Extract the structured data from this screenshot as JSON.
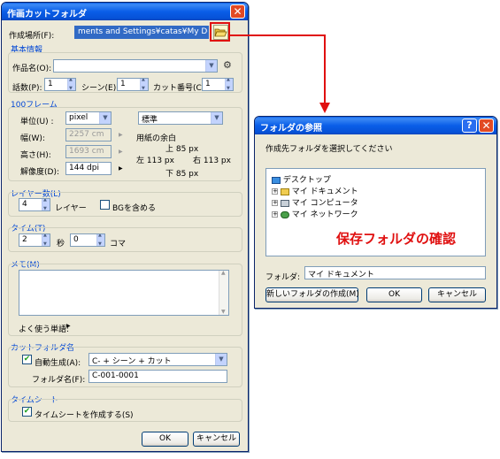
{
  "main_dialog": {
    "title": "作画カットフォルダ",
    "create_location_label": "作成場所(F):",
    "create_location_value": "ments and Settings¥catas¥My Documents",
    "basic_info_header": "基本情報",
    "work_name_label": "作品名(O):",
    "work_name_value": "",
    "episode_label": "話数(P):",
    "episode_value": "1",
    "scene_label": "シーン(E):",
    "scene_value": "1",
    "cut_label": "カット番号(C):",
    "cut_value": "1",
    "frame_header": "100フレーム",
    "unit_label": "単位(U) :",
    "unit_value": "pixel",
    "preset_value": "標準",
    "width_label": "幅(W):",
    "width_value": "2257 cm",
    "height_label": "高さ(H):",
    "height_value": "1693 cm",
    "resolution_label": "解像度(D):",
    "resolution_value": "144 dpi",
    "margin_title": "用紙の余白",
    "margin_top": "上 85 px",
    "margin_left": "左 113 px",
    "margin_right": "右 113 px",
    "margin_bottom": "下 85 px",
    "layer_header": "レイヤー数(L)",
    "layer_value": "4",
    "layer_unit": "レイヤー",
    "include_bg_label": "BGを含める",
    "timing_header": "タイム(T)",
    "seconds_value": "2",
    "seconds_unit": "秒",
    "koma_value": "0",
    "koma_unit": "コマ",
    "memo_header": "メモ(M)",
    "memo_value": "",
    "common_words_label": "よく使う単語:",
    "cut_folder_header": "カットフォルダ名",
    "auto_generate_label": "自動生成(A):",
    "auto_generate_checked": true,
    "auto_generate_value": "C- + シーン + カット",
    "folder_name_label": "フォルダ名(F):",
    "folder_name_value": "C-001-0001",
    "timesheet_header": "タイムシート",
    "timesheet_label": "タイムシートを作成する(S)",
    "timesheet_checked": true,
    "ok_label": "OK",
    "cancel_label": "キャンセル"
  },
  "browse_dialog": {
    "title": "フォルダの参照",
    "instruction": "作成先フォルダを選択してください",
    "tree": [
      {
        "label": "デスクトップ",
        "icon": "desktop-icon"
      },
      {
        "label": "マイ ドキュメント",
        "icon": "folder-icon"
      },
      {
        "label": "マイ コンピュータ",
        "icon": "computer-icon"
      },
      {
        "label": "マイ ネットワーク",
        "icon": "network-icon"
      }
    ],
    "folder_label": "フォルダ:",
    "folder_value": "マイ ドキュメント",
    "new_folder_label": "新しいフォルダの作成(M)",
    "ok_label": "OK",
    "cancel_label": "キャンセル"
  },
  "annotation": "保存フォルダの確認",
  "colors": {
    "title_blue": "#0a5ee8",
    "section_blue": "#0046d5",
    "annotation_red": "#e01010",
    "dialog_bg": "#ece9d8"
  }
}
